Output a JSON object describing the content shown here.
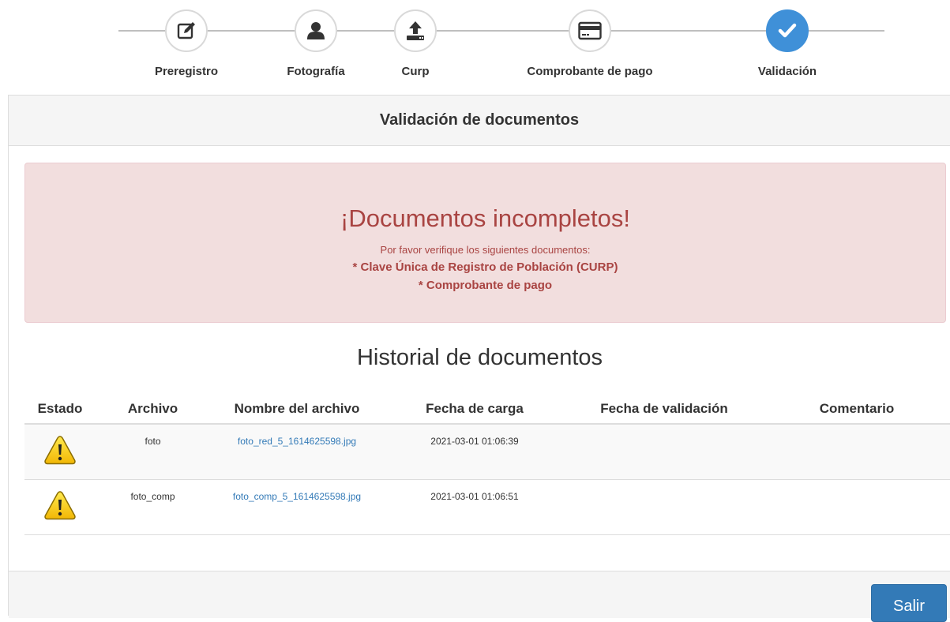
{
  "stepper": {
    "steps": [
      {
        "label": "Preregistro",
        "icon": "edit-icon"
      },
      {
        "label": "Fotografía",
        "icon": "user-icon"
      },
      {
        "label": "Curp",
        "icon": "upload-icon"
      },
      {
        "label": "Comprobante de pago",
        "icon": "credit-card-icon"
      },
      {
        "label": "Validación",
        "icon": "check-icon",
        "active": true
      }
    ],
    "active_color": "#3f90d8"
  },
  "panel": {
    "title": "Validación de documentos"
  },
  "alert": {
    "title": "¡Documentos incompletos!",
    "subtitle": "Por favor verifique los siguientes documentos:",
    "items": [
      "* Clave Única de Registro de Población (CURP)",
      "* Comprobante de pago"
    ],
    "color": "#a94442",
    "background": "#f2dede"
  },
  "history": {
    "title": "Historial de documentos",
    "columns": [
      "Estado",
      "Archivo",
      "Nombre del archivo",
      "Fecha de carga",
      "Fecha de validación",
      "Comentario"
    ],
    "rows": [
      {
        "state_icon": "warning-icon",
        "archivo": "foto",
        "nombre": "foto_red_5_1614625598.jpg",
        "fecha_carga": "2021-03-01 01:06:39",
        "fecha_validacion": "",
        "comentario": ""
      },
      {
        "state_icon": "warning-icon",
        "archivo": "foto_comp",
        "nombre": "foto_comp_5_1614625598.jpg",
        "fecha_carga": "2021-03-01 01:06:51",
        "fecha_validacion": "",
        "comentario": ""
      }
    ]
  },
  "footer": {
    "exit_label": "Salir",
    "button_color": "#337ab7"
  }
}
